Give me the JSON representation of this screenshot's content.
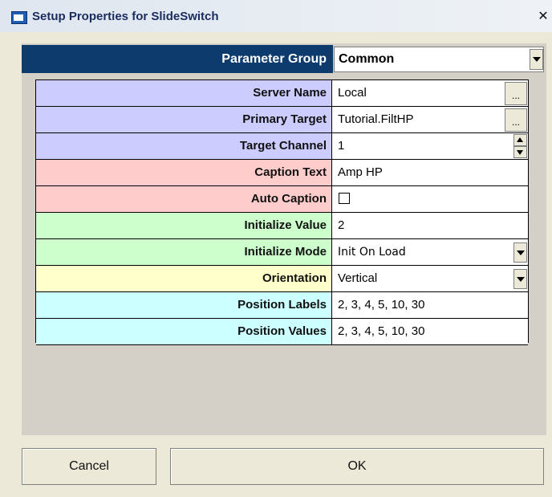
{
  "window": {
    "title": "Setup Properties for SlideSwitch",
    "close_glyph": "✕"
  },
  "parameter_group": {
    "label": "Parameter Group",
    "value": "Common"
  },
  "properties": [
    {
      "label": "Server Name",
      "value": "Local",
      "color": "#ccccff",
      "control": "text-ellipsis"
    },
    {
      "label": "Primary Target",
      "value": "Tutorial.FiltHP",
      "color": "#ccccff",
      "control": "text-ellipsis"
    },
    {
      "label": "Target Channel",
      "value": "1",
      "color": "#ccccff",
      "control": "spinner"
    },
    {
      "label": "Caption Text",
      "value": "Amp HP",
      "color": "#ffcccc",
      "control": "text"
    },
    {
      "label": "Auto Caption",
      "value": "",
      "color": "#ffcccc",
      "control": "checkbox"
    },
    {
      "label": "Initialize Value",
      "value": "2",
      "color": "#ccffcc",
      "control": "text"
    },
    {
      "label": "Initialize Mode",
      "value": "Init On Load",
      "color": "#ccffcc",
      "control": "dropdown"
    },
    {
      "label": "Orientation",
      "value": "Vertical",
      "color": "#ffffcc",
      "control": "dropdown"
    },
    {
      "label": "Position Labels",
      "value": "2, 3, 4, 5, 10, 30",
      "color": "#ccffff",
      "control": "text"
    },
    {
      "label": "Position Values",
      "value": "2, 3, 4, 5, 10, 30",
      "color": "#ccffff",
      "control": "text"
    }
  ],
  "ellipsis_label": "...",
  "buttons": {
    "cancel": "Cancel",
    "ok": "OK"
  }
}
